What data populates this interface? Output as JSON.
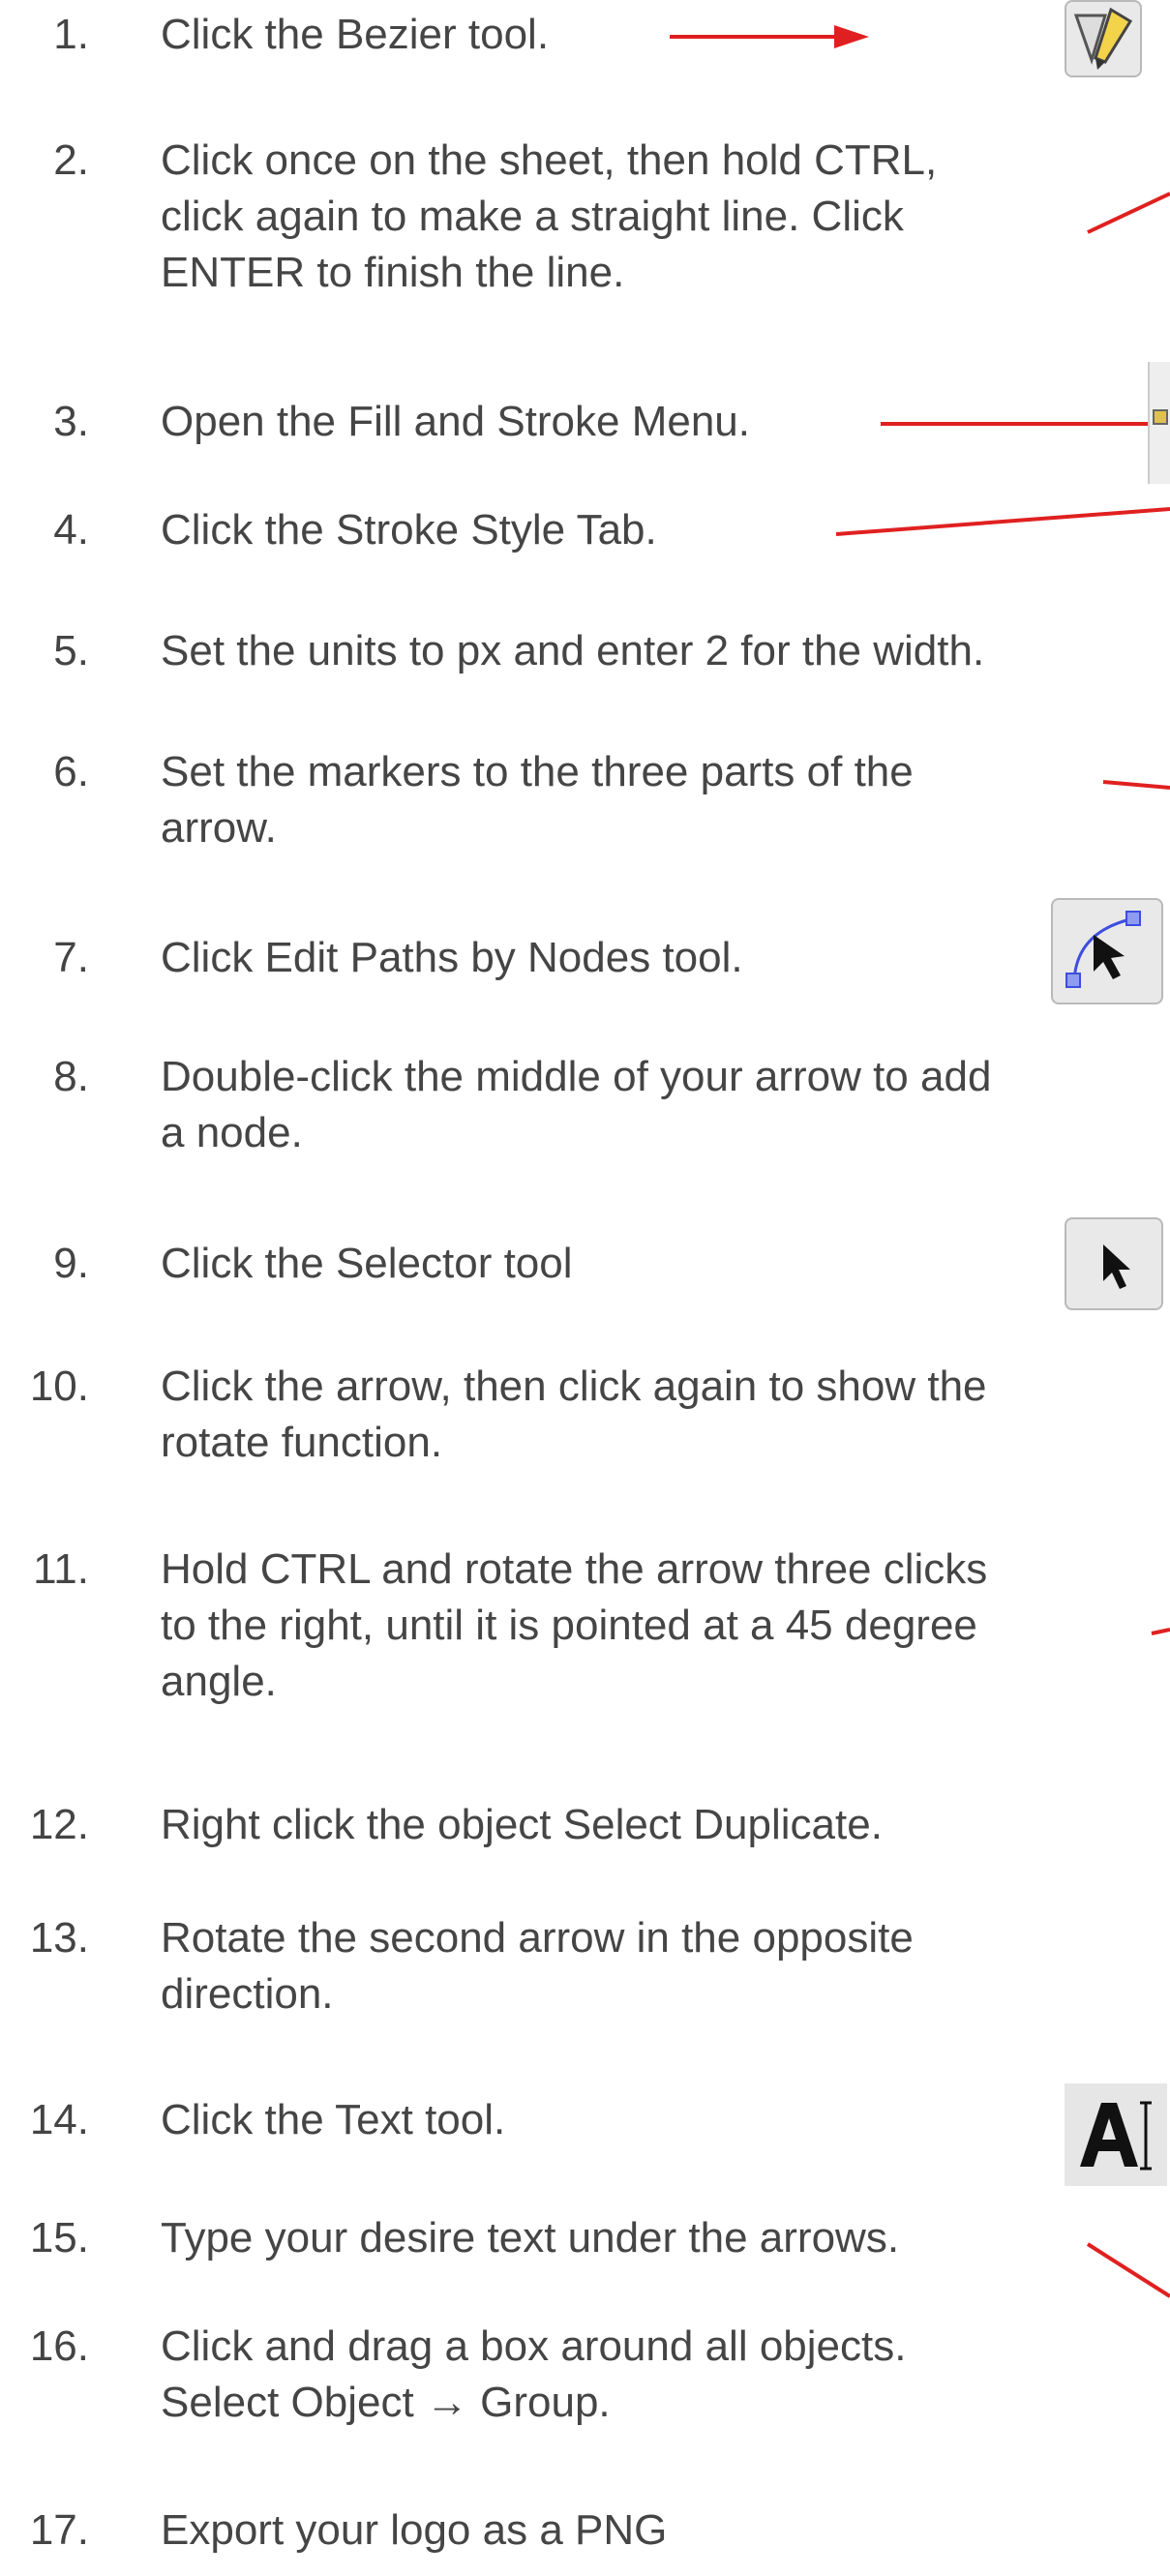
{
  "steps": [
    {
      "num": "1.",
      "lines": [
        "Click the Bezier tool."
      ],
      "pointer": true,
      "icon": "bezier-pen-icon"
    },
    {
      "num": "2.",
      "lines": [
        "Click once on the sheet, then hold CTRL,",
        "click again to make a straight line. Click",
        "ENTER to finish the line."
      ],
      "pointer": true
    },
    {
      "num": "3.",
      "lines": [
        "Open the Fill and Stroke Menu."
      ],
      "pointer": true,
      "icon": "fill-and-stroke-icon"
    },
    {
      "num": "4.",
      "lines": [
        "Click the Stroke Style Tab."
      ],
      "pointer": true
    },
    {
      "num": "5.",
      "lines": [
        "Set the units to px and enter 2 for the width."
      ]
    },
    {
      "num": "6.",
      "lines": [
        "Set the markers to the three parts of the",
        "arrow."
      ],
      "pointer": true
    },
    {
      "num": "7.",
      "lines": [
        "Click Edit Paths by Nodes tool."
      ],
      "icon": "edit-nodes-icon"
    },
    {
      "num": "8.",
      "lines": [
        "Double-click the middle of your arrow to add",
        "a node."
      ]
    },
    {
      "num": "9.",
      "lines": [
        "Click the Selector tool"
      ],
      "icon": "selector-arrow-icon"
    },
    {
      "num": "10.",
      "lines": [
        "Click the arrow, then click again to show the",
        "rotate function."
      ]
    },
    {
      "num": "11.",
      "lines": [
        "Hold CTRL and rotate the arrow three clicks",
        "to the right, until it is pointed at a 45 degree",
        "angle."
      ],
      "pointer": true
    },
    {
      "num": "12.",
      "lines": [
        "Right click the object  Select Duplicate."
      ]
    },
    {
      "num": "13.",
      "lines": [
        "Rotate the second arrow in the opposite",
        "direction."
      ]
    },
    {
      "num": "14.",
      "lines": [
        "Click the Text tool."
      ],
      "icon": "text-tool-icon"
    },
    {
      "num": "15.",
      "lines": [
        "Type your desire text under the arrows."
      ],
      "pointer": true
    },
    {
      "num": "16.",
      "lines": [
        "Click and drag a box around all objects.",
        "Select Object → Group."
      ]
    },
    {
      "num": "17.",
      "lines": [
        "Export your logo as a PNG"
      ]
    }
  ],
  "colors": {
    "pointer_red": "#e02020",
    "text": "#454545",
    "node_blue": "#3d4ee0"
  }
}
